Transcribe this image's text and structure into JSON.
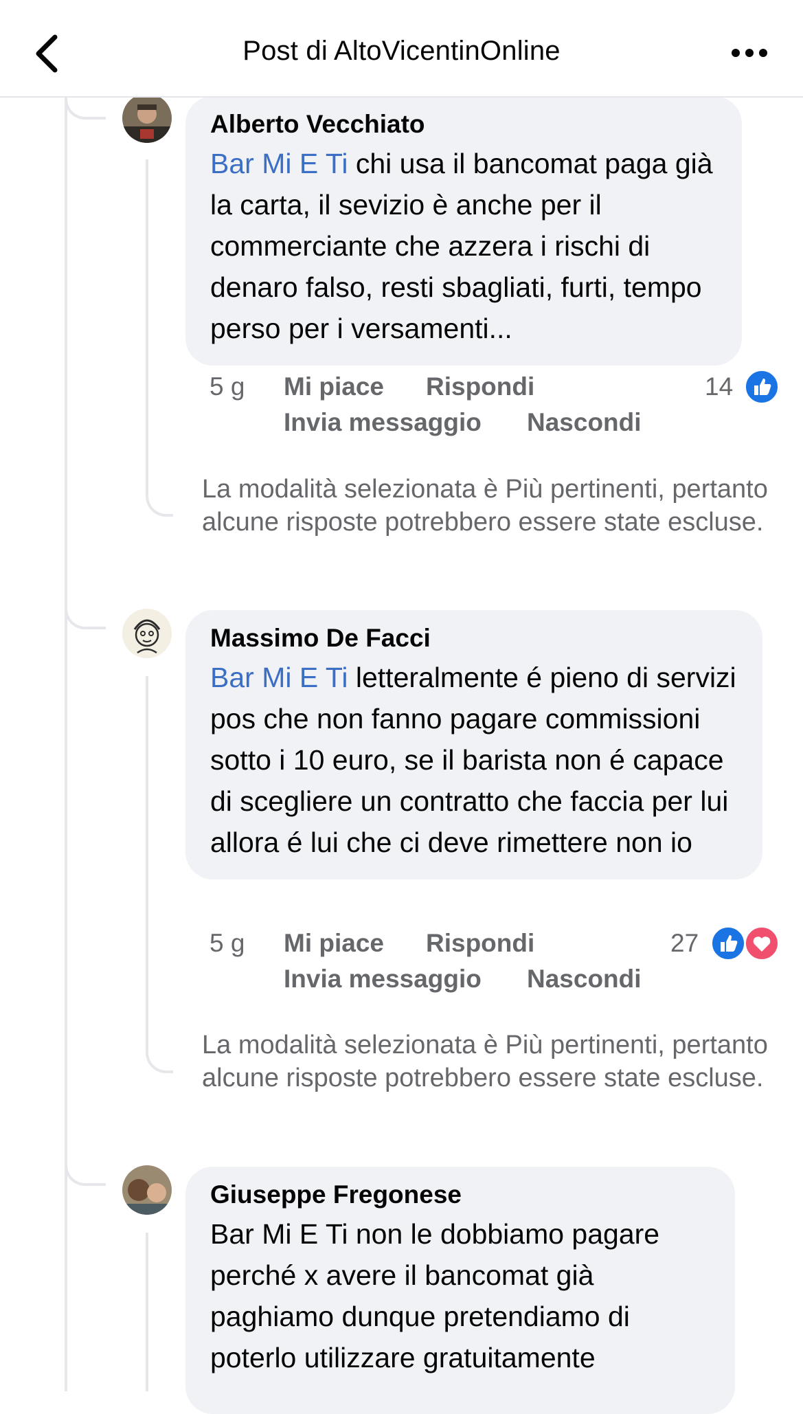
{
  "header": {
    "title": "Post di AltoVicentinOnline"
  },
  "comments": [
    {
      "author": "Alberto Vecchiato",
      "mention": "Bar Mi E Ti",
      "text": " chi usa il bancomat paga già la carta, il sevizio è anche per il commerciante che azzera i rischi di denaro falso, resti sbagliati, furti, tempo perso per i versamenti...",
      "time": "5 g",
      "like_label": "Mi piace",
      "reply_label": "Rispondi",
      "message_label": "Invia messaggio",
      "hide_label": "Nascondi",
      "reaction_count": "14",
      "reactions": [
        "like"
      ]
    },
    {
      "author": "Massimo De Facci",
      "mention": "Bar Mi E Ti",
      "text": " letteralmente é pieno di servizi pos che non fanno pagare commissioni sotto i 10 euro, se il barista non é capace di scegliere un contratto che faccia per lui allora é lui che ci deve rimettere non io",
      "time": "5 g",
      "like_label": "Mi piace",
      "reply_label": "Rispondi",
      "message_label": "Invia messaggio",
      "hide_label": "Nascondi",
      "reaction_count": "27",
      "reactions": [
        "like",
        "love"
      ]
    },
    {
      "author": "Giuseppe Fregonese",
      "text": "Bar Mi E Ti non le dobbiamo pagare perché x avere il bancomat già paghiamo dunque pretendiamo di poterlo utilizzare gratuitamente"
    }
  ],
  "notice": "La modalità selezionata è Più pertinenti, pertanto alcune risposte potrebbero essere state escluse.",
  "colors": {
    "mention": "#3b6ec5",
    "bubble": "#f0f2f5",
    "like": "#1b74e4",
    "love": "#f0506e"
  }
}
